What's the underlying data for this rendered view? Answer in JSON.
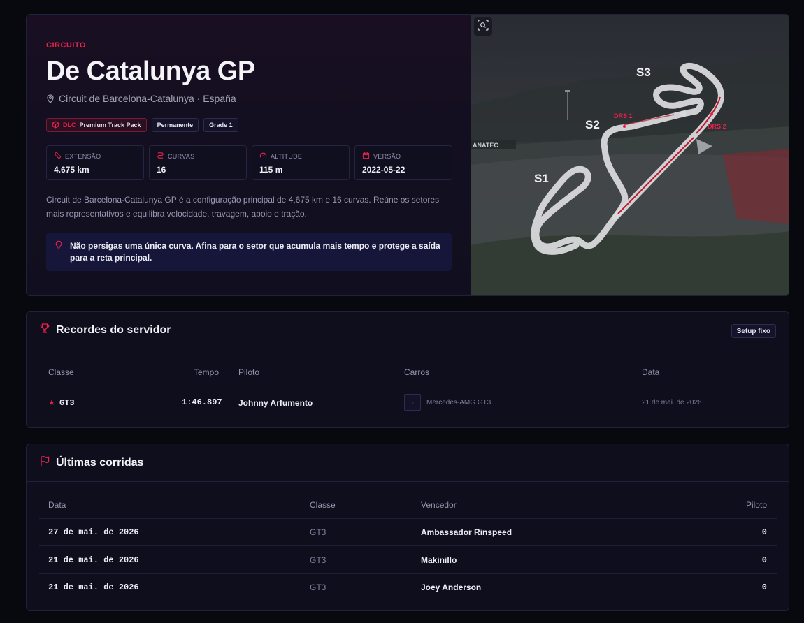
{
  "hero": {
    "eyebrow": "CIRCUITO",
    "title": "De Catalunya GP",
    "location": "Circuit de Barcelona-Catalunya · España",
    "tags": {
      "dlc_label": "DLC",
      "dlc_name": "Premium Track Pack",
      "type": "Permanente",
      "grade": "Grade 1"
    },
    "stats": [
      {
        "label": "EXTENSÃO",
        "value": "4.675 km",
        "icon": "ruler-icon"
      },
      {
        "label": "CURVAS",
        "value": "16",
        "icon": "curves-icon"
      },
      {
        "label": "ALTITUDE",
        "value": "115 m",
        "icon": "gauge-icon"
      },
      {
        "label": "VERSÃO",
        "value": "2022-05-22",
        "icon": "calendar-icon"
      }
    ],
    "description": "Circuit de Barcelona-Catalunya GP é a configuração principal de 4,675 km e 16 curvas. Reúne os setores mais representativos e equilibra velocidade, travagem, apoio e tração.",
    "tip": "Não persigas uma única curva. Afina para o setor que acumula mais tempo e protege a saída para a reta principal.",
    "map": {
      "sectors": [
        "S1",
        "S2",
        "S3"
      ],
      "drs": [
        "DRS 1",
        "DRS 2"
      ],
      "sign_text": "ANATEC"
    }
  },
  "records": {
    "title": "Recordes do servidor",
    "setup_label": "Setup fixo",
    "headers": {
      "classe": "Classe",
      "tempo": "Tempo",
      "piloto": "Piloto",
      "carros": "Carros",
      "data": "Data"
    },
    "rows": [
      {
        "classe": "GT3",
        "tempo": "1:46.897",
        "piloto": "Johnny Arfumento",
        "carro": "Mercedes-AMG GT3",
        "data": "21 de mai. de 2026"
      }
    ]
  },
  "races": {
    "title": "Últimas corridas",
    "headers": {
      "data": "Data",
      "classe": "Classe",
      "vencedor": "Vencedor",
      "piloto": "Piloto"
    },
    "rows": [
      {
        "data": "27 de mai. de 2026",
        "classe": "GT3",
        "vencedor": "Ambassador Rinspeed",
        "piloto": "0"
      },
      {
        "data": "21 de mai. de 2026",
        "classe": "GT3",
        "vencedor": "Makinillo",
        "piloto": "0"
      },
      {
        "data": "21 de mai. de 2026",
        "classe": "GT3",
        "vencedor": "Joey Anderson",
        "piloto": "0"
      }
    ]
  },
  "colors": {
    "accent": "#e8224a",
    "background": "#08080f",
    "card": "#0f0e1c",
    "tip_bg": "#16153a"
  }
}
